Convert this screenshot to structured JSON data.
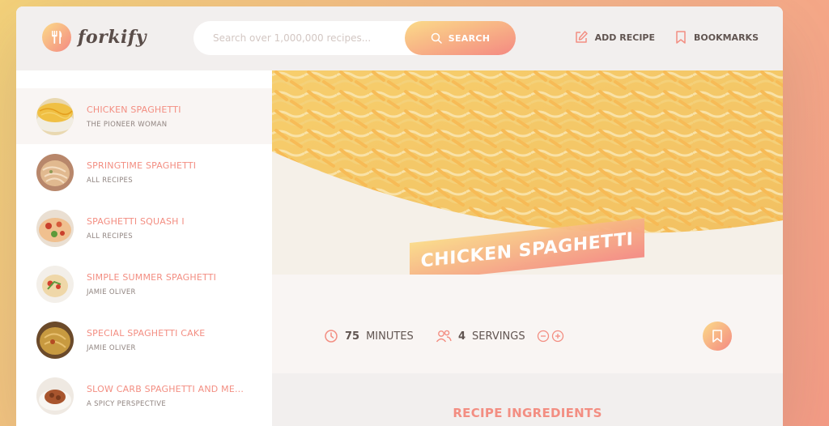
{
  "brand": {
    "name": "forkify"
  },
  "search": {
    "placeholder": "Search over 1,000,000 recipes...",
    "button_label": "SEARCH"
  },
  "nav": {
    "add_recipe": "ADD RECIPE",
    "bookmarks": "BOOKMARKS"
  },
  "results": [
    {
      "title": "CHICKEN SPAGHETTI",
      "publisher": "THE PIONEER WOMAN",
      "active": true
    },
    {
      "title": "SPRINGTIME SPAGHETTI",
      "publisher": "ALL RECIPES",
      "active": false
    },
    {
      "title": "SPAGHETTI SQUASH I",
      "publisher": "ALL RECIPES",
      "active": false
    },
    {
      "title": "SIMPLE SUMMER SPAGHETTI",
      "publisher": "JAMIE OLIVER",
      "active": false
    },
    {
      "title": "SPECIAL SPAGHETTI CAKE",
      "publisher": "JAMIE OLIVER",
      "active": false
    },
    {
      "title": "SLOW CARB SPAGHETTI AND ME...",
      "publisher": "A SPICY PERSPECTIVE",
      "active": false
    }
  ],
  "recipe": {
    "title": "CHICKEN SPAGHETTI",
    "minutes": "75",
    "minutes_unit": "MINUTES",
    "servings": "4",
    "servings_unit": "SERVINGS",
    "ingredients_heading": "RECIPE INGREDIENTS"
  },
  "colors": {
    "accent": "#f38e82",
    "gradient_start": "#fbdb89",
    "gradient_end": "#f48982"
  },
  "icons": [
    "fork-knife-icon",
    "search-icon",
    "edit-icon",
    "bookmark-icon",
    "clock-icon",
    "users-icon",
    "minus-circle-icon",
    "plus-circle-icon"
  ]
}
